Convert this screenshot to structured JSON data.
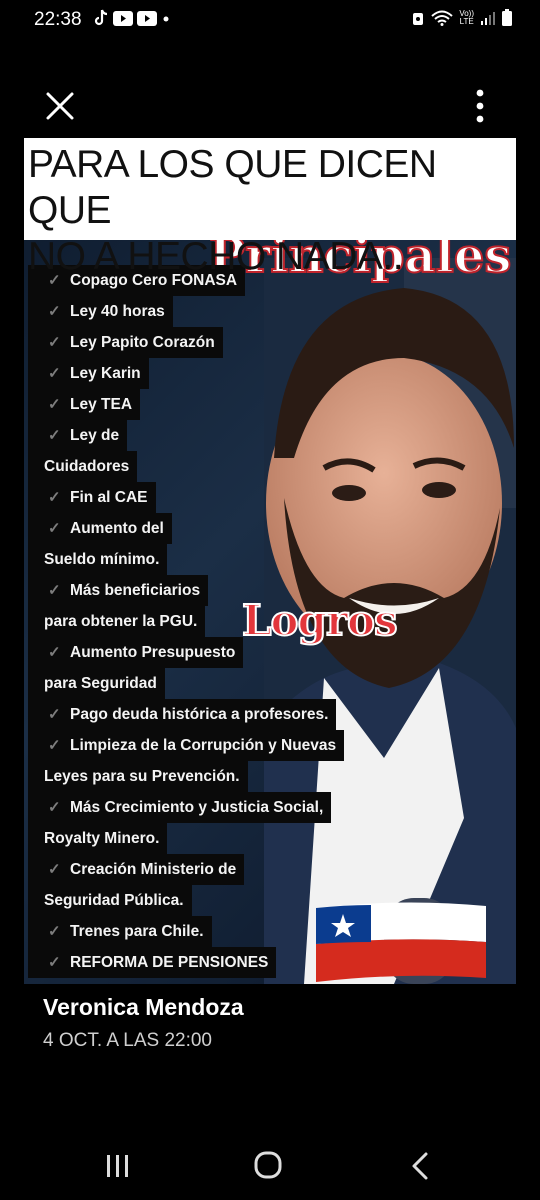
{
  "status_bar": {
    "time": "22:38",
    "lte_label_top": "Vo))",
    "lte_label_bottom": "LTE"
  },
  "toolbar": {
    "close_icon": "close-icon",
    "more_icon": "more-vert-icon"
  },
  "post": {
    "caption_line1": "PARA LOS QUE DICEN QUE",
    "caption_line2": "NO A HECHO NADA..",
    "banner_title": "Principales",
    "badge": "Logros",
    "achievements": [
      {
        "text": "Copago Cero FONASA",
        "check": true
      },
      {
        "text": "Ley 40 horas",
        "check": true
      },
      {
        "text": "Ley Papito Corazón",
        "check": true
      },
      {
        "text": "Ley Karin",
        "check": true
      },
      {
        "text": "Ley TEA",
        "check": true
      },
      {
        "text": "Ley de",
        "check": true
      },
      {
        "text": "Cuidadores",
        "check": false
      },
      {
        "text": "Fin al CAE",
        "check": true
      },
      {
        "text": "Aumento del",
        "check": true
      },
      {
        "text": "Sueldo mínimo.",
        "check": false
      },
      {
        "text": "Más beneficiarios",
        "check": true
      },
      {
        "text": "para obtener la PGU.",
        "check": false
      },
      {
        "text": "Aumento Presupuesto",
        "check": true
      },
      {
        "text": "para Seguridad",
        "check": false
      },
      {
        "text": "Pago deuda histórica a profesores.",
        "check": true
      },
      {
        "text": "Limpieza de la Corrupción y Nuevas",
        "check": true
      },
      {
        "text": "Leyes para su Prevención.",
        "check": false
      },
      {
        "text": "Más Crecimiento y Justicia Social,",
        "check": true
      },
      {
        "text": "Royalty Minero.",
        "check": false
      },
      {
        "text": "Creación Ministerio de",
        "check": true
      },
      {
        "text": "Seguridad Pública.",
        "check": false
      },
      {
        "text": "Trenes para Chile.",
        "check": true
      },
      {
        "text": "REFORMA DE PENSIONES",
        "check": true
      }
    ],
    "author": "Veronica Mendoza",
    "timestamp": "4 OCT. A LAS 22:00"
  },
  "nav": {
    "recents": "recents-icon",
    "home": "home-icon",
    "back": "back-icon"
  },
  "colors": {
    "background": "#000000",
    "badge_red": "#e2363b",
    "caption_bg": "#ffffff"
  }
}
